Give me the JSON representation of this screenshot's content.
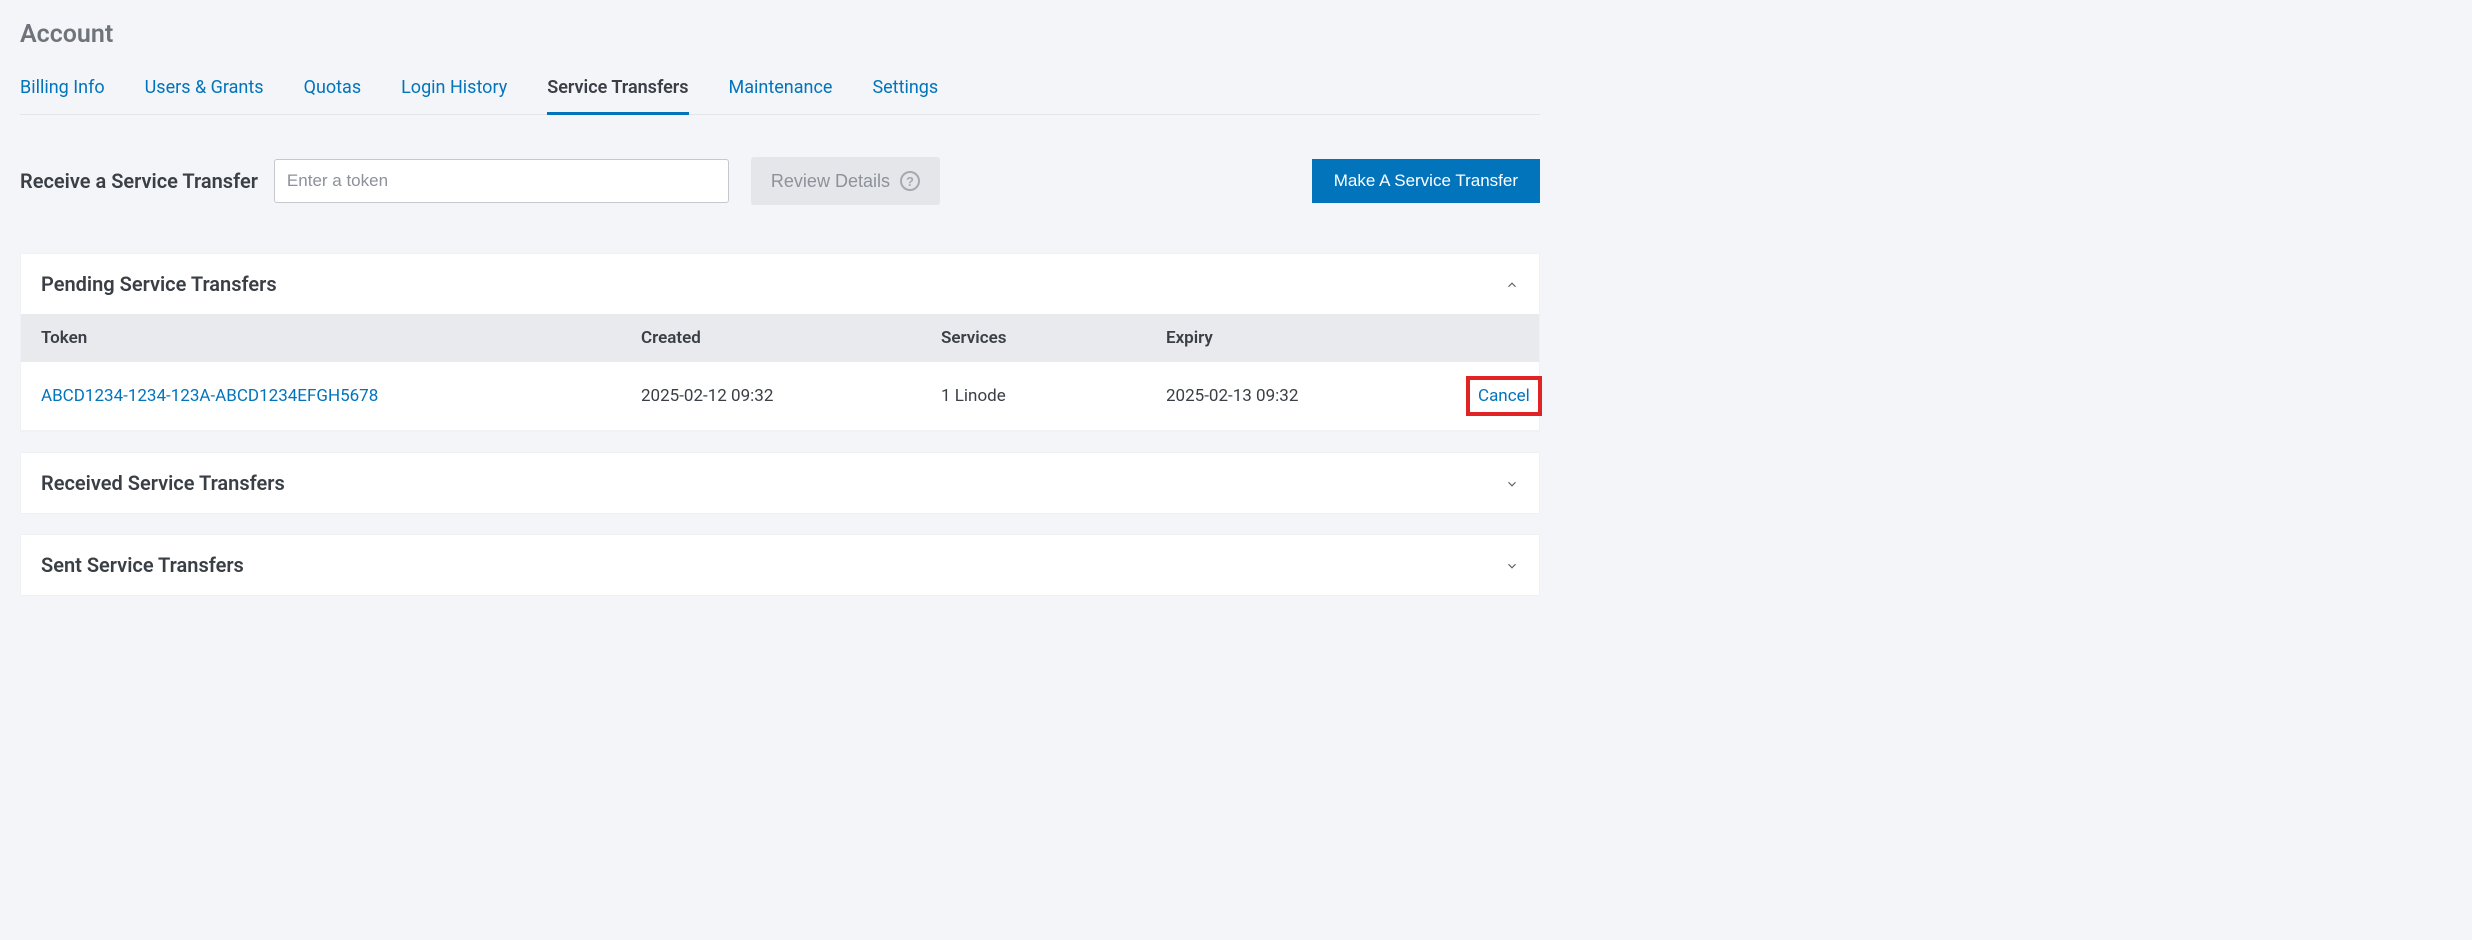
{
  "page": {
    "title": "Account"
  },
  "tabs": [
    {
      "label": "Billing Info",
      "active": false
    },
    {
      "label": "Users & Grants",
      "active": false
    },
    {
      "label": "Quotas",
      "active": false
    },
    {
      "label": "Login History",
      "active": false
    },
    {
      "label": "Service Transfers",
      "active": true
    },
    {
      "label": "Maintenance",
      "active": false
    },
    {
      "label": "Settings",
      "active": false
    }
  ],
  "receive": {
    "label": "Receive a Service Transfer",
    "placeholder": "Enter a token",
    "review_button": "Review Details",
    "make_button": "Make A Service Transfer"
  },
  "pending": {
    "title": "Pending Service Transfers",
    "columns": {
      "token": "Token",
      "created": "Created",
      "services": "Services",
      "expiry": "Expiry"
    },
    "rows": [
      {
        "token": "ABCD1234-1234-123A-ABCD1234EFGH5678",
        "created": "2025-02-12 09:32",
        "services": "1 Linode",
        "expiry": "2025-02-13 09:32",
        "action": "Cancel"
      }
    ]
  },
  "received": {
    "title": "Received Service Transfers"
  },
  "sent": {
    "title": "Sent Service Transfers"
  }
}
